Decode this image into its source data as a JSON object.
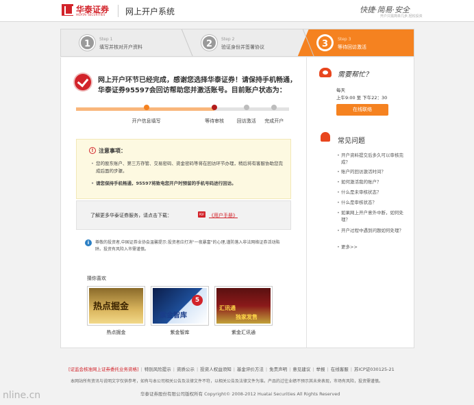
{
  "header": {
    "logo_cn": "华泰证券",
    "logo_en": "HUATAI SECURITIES",
    "system_title": "网上开户系统",
    "slogan": "快捷·简易·安全",
    "slogan_sub": "开户只需简单几步,轻松投资"
  },
  "steps": [
    {
      "no": "1",
      "step_label": "Step 1",
      "label": "填写并核对开户资料"
    },
    {
      "no": "2",
      "step_label": "Step 2",
      "label": "验证身份并签署协议"
    },
    {
      "no": "3",
      "step_label": "Step 3",
      "label": "等待回访激活"
    }
  ],
  "main": {
    "headline": "网上开户环节已经完成，感谢您选择华泰证券！请保持手机畅通，华泰证券95597会回访帮助您并激活账号。目前账户状态为：",
    "progress": {
      "fraction": 0.65,
      "stages": [
        {
          "label": "开户信息填写",
          "pos": 0.33,
          "state": "done"
        },
        {
          "label": "等待审核",
          "pos": 0.65,
          "state": "current"
        },
        {
          "label": "回访激活",
          "pos": 0.8,
          "state": "pending"
        },
        {
          "label": "完成开户",
          "pos": 0.93,
          "state": "pending"
        }
      ]
    },
    "notice": {
      "title": "注意事项：",
      "items": [
        "您的股东账户、第三方存管、交易密码、资金密码等将在回访环节办理，稍后将有客服协助您完成后面的步骤。",
        "请您保持手机畅通，95597将致电您开户时预留的手机号码进行回访。"
      ]
    },
    "manual": {
      "text": "了解更多华泰证券服务，请点击下载：",
      "pdf_tag": "PDF",
      "link": "《用户手册》"
    },
    "info": "尊敬的投资者,中国证券业协会温馨提示:投资者应打消\"一夜暴富\"的心理,谨防落入非法网络证券活动陷阱。投资有风险入市需谨慎。",
    "like_title": "猜你喜欢",
    "thumbnails": [
      {
        "caption": "热点掘金",
        "art": "热点掘金"
      },
      {
        "caption": "紫金智库",
        "art": "紫金智库",
        "badge": "5"
      },
      {
        "caption": "紫金汇讯通",
        "art": "汇讯通",
        "art_sub": "独家发售"
      }
    ]
  },
  "help": {
    "title": "需要帮忙？",
    "day": "每天",
    "hours": "上午9:00 至 下午22：30",
    "contact_button": "在线联络"
  },
  "faq": {
    "title": "常见问题",
    "items": [
      "开户资料提交后多久可以审核完成？",
      "账户的回访激活时间？",
      "如何激活我的账户？",
      "什么是未审核状态？",
      "什么是审核状态？",
      "如果网上开户意外中断，如何处理？",
      "开户过程中遇到问题如何处理？",
      "更多>>"
    ]
  },
  "footer": {
    "links": [
      "[证监会核准网上证券委托业务资格]",
      "特别风险提示",
      "资质公示",
      "投资人权益须知",
      "基金评价方法",
      "免责声明",
      "意见建议",
      "举报",
      "在线客服",
      "苏ICP证030125-21"
    ],
    "note": "本网站所有资讯与说明文字仅供参考，如有与本公司相关公告及法律文件不符，以相关公告及法律文件为准。产品的过往业绩不预示其未来表现，市场有风险，投资需谨慎。",
    "copyright": "华泰证券股份有限公司版权所有     Copyright© 2008-2012 Huatai Securities All Rights Reserved"
  },
  "watermark": "nline.cn"
}
